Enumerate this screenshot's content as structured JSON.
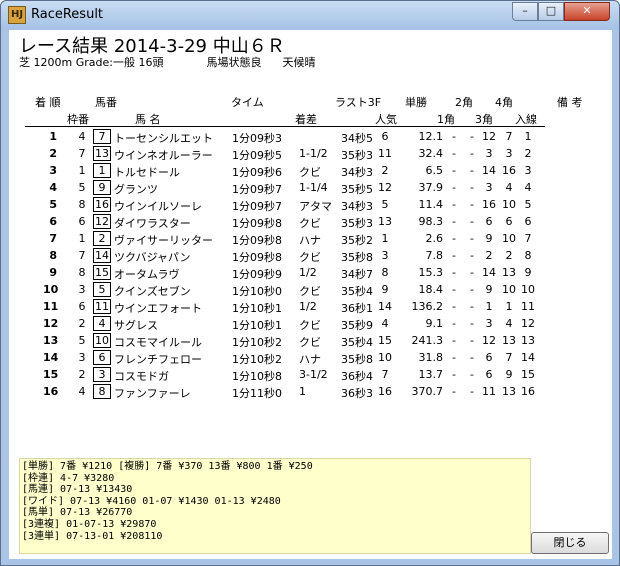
{
  "window": {
    "title": "RaceResult",
    "icon_label": "HJ",
    "min_glyph": "–",
    "max_glyph": "□",
    "close_glyph": "✕"
  },
  "race": {
    "title": "レース結果 2014-3-29 中山６Ｒ",
    "course": "芝 1200m Grade:一般 16頭",
    "track": "馬場状態良",
    "weather": "天候晴"
  },
  "headers": {
    "top": [
      "着 順",
      "馬番",
      "タイム",
      "ラスト3F",
      "単勝",
      "2角",
      "4角",
      "備 考"
    ],
    "bottom": [
      "枠番",
      "馬 名",
      "着差",
      "人気",
      "1角",
      "3角",
      "入線"
    ]
  },
  "rows": [
    {
      "rank": "1",
      "waku": "4",
      "num": "7",
      "name": "トーセンシルエット",
      "time": "1分09秒3",
      "diff": "",
      "last3f": "34秒5",
      "pop": "6",
      "odds": "12.1",
      "p1": "-",
      "p2": "-",
      "p3": "12",
      "p4": "7",
      "fin": "1"
    },
    {
      "rank": "2",
      "waku": "7",
      "num": "13",
      "name": "ウインネオルーラー",
      "time": "1分09秒5",
      "diff": "1-1/2",
      "last3f": "35秒3",
      "pop": "11",
      "odds": "32.4",
      "p1": "-",
      "p2": "-",
      "p3": "3",
      "p4": "3",
      "fin": "2"
    },
    {
      "rank": "3",
      "waku": "1",
      "num": "1",
      "name": "トルセドール",
      "time": "1分09秒6",
      "diff": "クビ",
      "last3f": "34秒3",
      "pop": "2",
      "odds": "6.5",
      "p1": "-",
      "p2": "-",
      "p3": "14",
      "p4": "16",
      "fin": "3"
    },
    {
      "rank": "4",
      "waku": "5",
      "num": "9",
      "name": "グランツ",
      "time": "1分09秒7",
      "diff": "1-1/4",
      "last3f": "35秒5",
      "pop": "12",
      "odds": "37.9",
      "p1": "-",
      "p2": "-",
      "p3": "3",
      "p4": "4",
      "fin": "4"
    },
    {
      "rank": "5",
      "waku": "8",
      "num": "16",
      "name": "ウインイルソーレ",
      "time": "1分09秒7",
      "diff": "アタマ",
      "last3f": "34秒3",
      "pop": "5",
      "odds": "11.4",
      "p1": "-",
      "p2": "-",
      "p3": "16",
      "p4": "10",
      "fin": "5"
    },
    {
      "rank": "6",
      "waku": "6",
      "num": "12",
      "name": "ダイワラスター",
      "time": "1分09秒8",
      "diff": "クビ",
      "last3f": "35秒3",
      "pop": "13",
      "odds": "98.3",
      "p1": "-",
      "p2": "-",
      "p3": "6",
      "p4": "6",
      "fin": "6"
    },
    {
      "rank": "7",
      "waku": "1",
      "num": "2",
      "name": "ヴァイサーリッター",
      "time": "1分09秒8",
      "diff": "ハナ",
      "last3f": "35秒2",
      "pop": "1",
      "odds": "2.6",
      "p1": "-",
      "p2": "-",
      "p3": "9",
      "p4": "10",
      "fin": "7"
    },
    {
      "rank": "8",
      "waku": "7",
      "num": "14",
      "name": "ツクバジャパン",
      "time": "1分09秒8",
      "diff": "クビ",
      "last3f": "35秒8",
      "pop": "3",
      "odds": "7.8",
      "p1": "-",
      "p2": "-",
      "p3": "2",
      "p4": "2",
      "fin": "8"
    },
    {
      "rank": "9",
      "waku": "8",
      "num": "15",
      "name": "オータムラヴ",
      "time": "1分09秒9",
      "diff": "1/2",
      "last3f": "34秒7",
      "pop": "8",
      "odds": "15.3",
      "p1": "-",
      "p2": "-",
      "p3": "14",
      "p4": "13",
      "fin": "9"
    },
    {
      "rank": "10",
      "waku": "3",
      "num": "5",
      "name": "クインズセブン",
      "time": "1分10秒0",
      "diff": "クビ",
      "last3f": "35秒4",
      "pop": "9",
      "odds": "18.4",
      "p1": "-",
      "p2": "-",
      "p3": "9",
      "p4": "10",
      "fin": "10"
    },
    {
      "rank": "11",
      "waku": "6",
      "num": "11",
      "name": "ウインエフォート",
      "time": "1分10秒1",
      "diff": "1/2",
      "last3f": "36秒1",
      "pop": "14",
      "odds": "136.2",
      "p1": "-",
      "p2": "-",
      "p3": "1",
      "p4": "1",
      "fin": "11"
    },
    {
      "rank": "12",
      "waku": "2",
      "num": "4",
      "name": "サグレス",
      "time": "1分10秒1",
      "diff": "クビ",
      "last3f": "35秒9",
      "pop": "4",
      "odds": "9.1",
      "p1": "-",
      "p2": "-",
      "p3": "3",
      "p4": "4",
      "fin": "12"
    },
    {
      "rank": "13",
      "waku": "5",
      "num": "10",
      "name": "コスモマイルール",
      "time": "1分10秒2",
      "diff": "クビ",
      "last3f": "35秒4",
      "pop": "15",
      "odds": "241.3",
      "p1": "-",
      "p2": "-",
      "p3": "12",
      "p4": "13",
      "fin": "13"
    },
    {
      "rank": "14",
      "waku": "3",
      "num": "6",
      "name": "フレンチフェロー",
      "time": "1分10秒2",
      "diff": "ハナ",
      "last3f": "35秒8",
      "pop": "10",
      "odds": "31.8",
      "p1": "-",
      "p2": "-",
      "p3": "6",
      "p4": "7",
      "fin": "14"
    },
    {
      "rank": "15",
      "waku": "2",
      "num": "3",
      "name": "コスモドガ",
      "time": "1分10秒8",
      "diff": "3-1/2",
      "last3f": "36秒4",
      "pop": "7",
      "odds": "13.7",
      "p1": "-",
      "p2": "-",
      "p3": "6",
      "p4": "9",
      "fin": "15"
    },
    {
      "rank": "16",
      "waku": "4",
      "num": "8",
      "name": "ファンファーレ",
      "time": "1分11秒0",
      "diff": "1",
      "last3f": "36秒3",
      "pop": "16",
      "odds": "370.7",
      "p1": "-",
      "p2": "-",
      "p3": "11",
      "p4": "13",
      "fin": "16"
    }
  ],
  "payouts": [
    "[単勝] 7番 ¥1210    [複勝] 7番 ¥370  13番 ¥800  1番 ¥250",
    "[枠連] 4-7 ¥3280",
    "[馬連] 07-13 ¥13430",
    "[ワイド] 07-13 ¥4160  01-07 ¥1430  01-13 ¥2480",
    "[馬単] 07-13 ¥26770",
    "[3連複] 01-07-13 ¥29870",
    "[3連単] 07-13-01 ¥208110"
  ],
  "close_label": "閉じる"
}
